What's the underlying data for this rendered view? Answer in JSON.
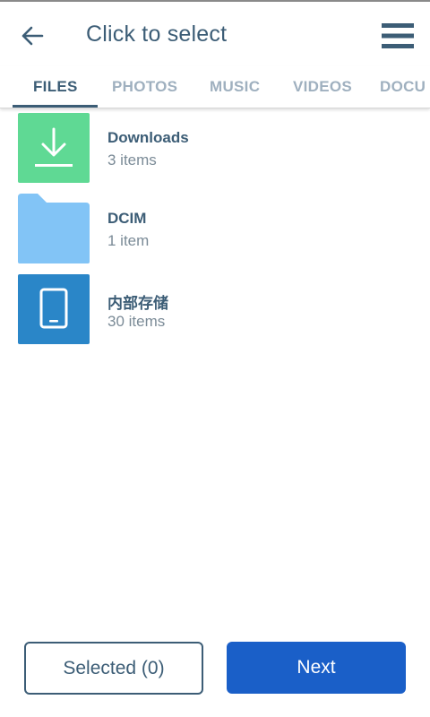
{
  "header": {
    "title": "Click to select",
    "back_icon": "arrow-left-icon",
    "menu_icon": "hamburger-menu-icon"
  },
  "tabs": [
    {
      "label": "FILES",
      "active": true
    },
    {
      "label": "PHOTOS",
      "active": false
    },
    {
      "label": "MUSIC",
      "active": false
    },
    {
      "label": "VIDEOS",
      "active": false
    },
    {
      "label": "DOCU",
      "active": false
    }
  ],
  "items": [
    {
      "name": "Downloads",
      "count": "3 items",
      "icon": "download-icon",
      "color": "#5fd994"
    },
    {
      "name": "DCIM",
      "count": "1 item",
      "icon": "folder-icon",
      "color": "#82c4f6"
    },
    {
      "name": "内部存储",
      "count": "30 items",
      "icon": "phone-icon",
      "color": "#2a86c8"
    }
  ],
  "buttons": {
    "selected_label": "Selected (0)",
    "next_label": "Next"
  },
  "colors": {
    "primary": "#3c5d76",
    "accent": "#1a5fc8",
    "tab_inactive": "#9fb0bf"
  }
}
